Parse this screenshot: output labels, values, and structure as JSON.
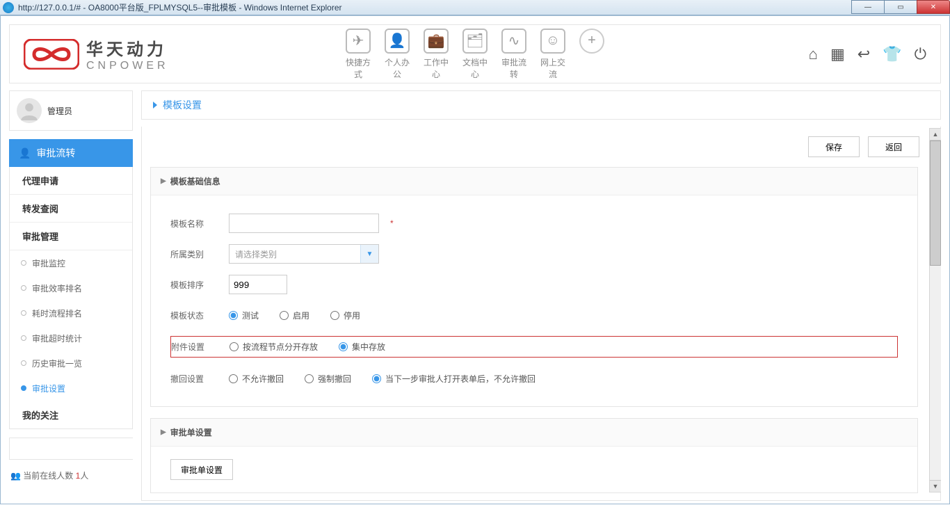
{
  "window": {
    "title": "http://127.0.0.1/# - OA8000平台版_FPLMYSQL5--审批模板 - Windows Internet Explorer"
  },
  "logo": {
    "cn": "华天动力",
    "en": "CNPOWER"
  },
  "topnav": [
    {
      "label": "快捷方式",
      "glyph": "✈"
    },
    {
      "label": "个人办公",
      "glyph": "👤"
    },
    {
      "label": "工作中心",
      "glyph": "💼"
    },
    {
      "label": "文档中心",
      "glyph": "🗂"
    },
    {
      "label": "审批流转",
      "glyph": "∿"
    },
    {
      "label": "网上交流",
      "glyph": "☺"
    }
  ],
  "plus_glyph": "+",
  "top_icons": {
    "home": "⌂",
    "apps": "▦",
    "back": "↩",
    "shirt": "👕",
    "power": "⏻"
  },
  "user": {
    "name": "管理员"
  },
  "side_section": "审批流转",
  "side_items": {
    "i0": "代理申请",
    "i1": "转发查阅",
    "i2": "审批管理",
    "subs": {
      "s0": "审批监控",
      "s1": "审批效率排名",
      "s2": "耗时流程排名",
      "s3": "审批超时统计",
      "s4": "历史审批一览",
      "s5": "审批设置"
    },
    "i3": "我的关注"
  },
  "online": {
    "label": "当前在线人数",
    "count": "1",
    "unit": "人"
  },
  "breadcrumb": "模板设置",
  "actions": {
    "save": "保存",
    "back": "返回"
  },
  "panel1": {
    "title": "模板基础信息",
    "name_label": "模板名称",
    "cat_label": "所属类别",
    "cat_placeholder": "请选择类别",
    "order_label": "模板排序",
    "order_value": "999",
    "state_label": "模板状态",
    "state_opts": {
      "o0": "测试",
      "o1": "启用",
      "o2": "停用"
    },
    "attach_label": "附件设置",
    "attach_opts": {
      "o0": "按流程节点分开存放",
      "o1": "集中存放"
    },
    "recall_label": "撤回设置",
    "recall_opts": {
      "o0": "不允许撤回",
      "o1": "强制撤回",
      "o2": "当下一步审批人打开表单后，不允许撤回"
    }
  },
  "panel2": {
    "title": "审批单设置",
    "btn": "审批单设置"
  }
}
